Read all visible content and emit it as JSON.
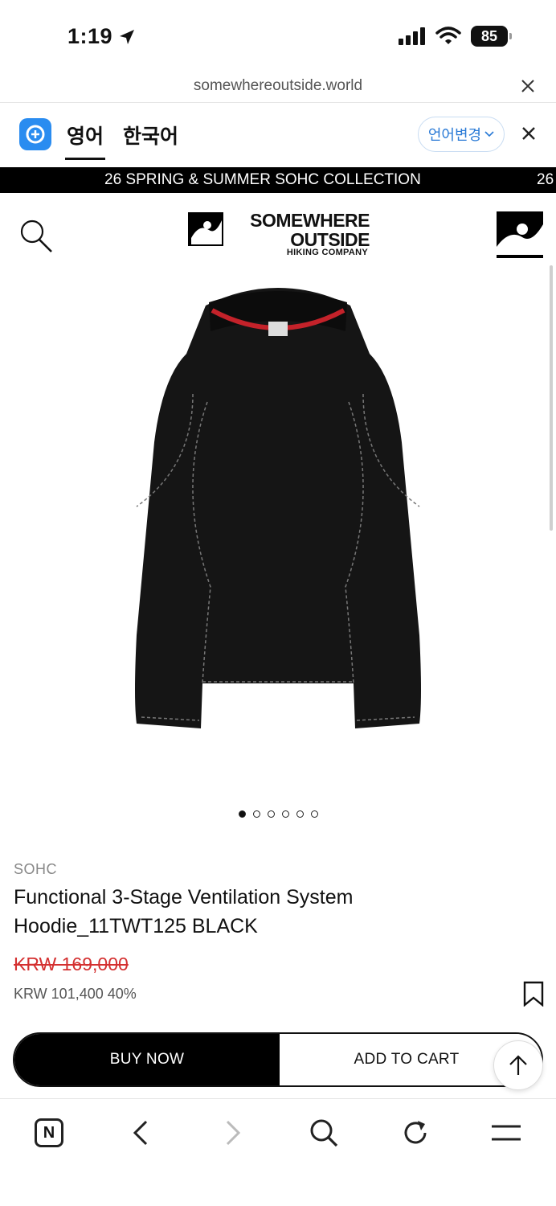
{
  "status": {
    "time": "1:19",
    "battery": "85"
  },
  "browser": {
    "url": "somewhereoutside.world"
  },
  "translate": {
    "tab_active": "영어",
    "tab_other": "한국어",
    "change_lang": "언어변경"
  },
  "announcement": {
    "text": "26 SPRING & SUMMER SOHC COLLECTION",
    "text_repeat": "26"
  },
  "brand_logo": {
    "line1": "SOMEWHERE",
    "line2": "OUTSIDE",
    "line3": "HIKING COMPANY"
  },
  "gallery": {
    "dot_count": 6,
    "active_index": 0
  },
  "product": {
    "brand": "SOHC",
    "title": "Functional 3-Stage Ventilation System Hoodie_11TWT125 BLACK",
    "original_price": "KRW 169,000",
    "sale_price": "KRW 101,400 40%"
  },
  "actions": {
    "buy_now": "BUY NOW",
    "add_to_cart": "ADD TO CART"
  },
  "colors": {
    "accent_blue": "#2a8cf0",
    "sale_red": "#d43030",
    "black": "#000000"
  },
  "icons": [
    "location-arrow-icon",
    "signal-icon",
    "wifi-icon",
    "close-icon",
    "papago-icon",
    "chevron-down-icon",
    "search-icon",
    "brand-mark-icon",
    "bookmark-icon",
    "arrow-up-icon",
    "naver-icon",
    "back-icon",
    "forward-icon",
    "menu-icon",
    "reload-icon"
  ]
}
